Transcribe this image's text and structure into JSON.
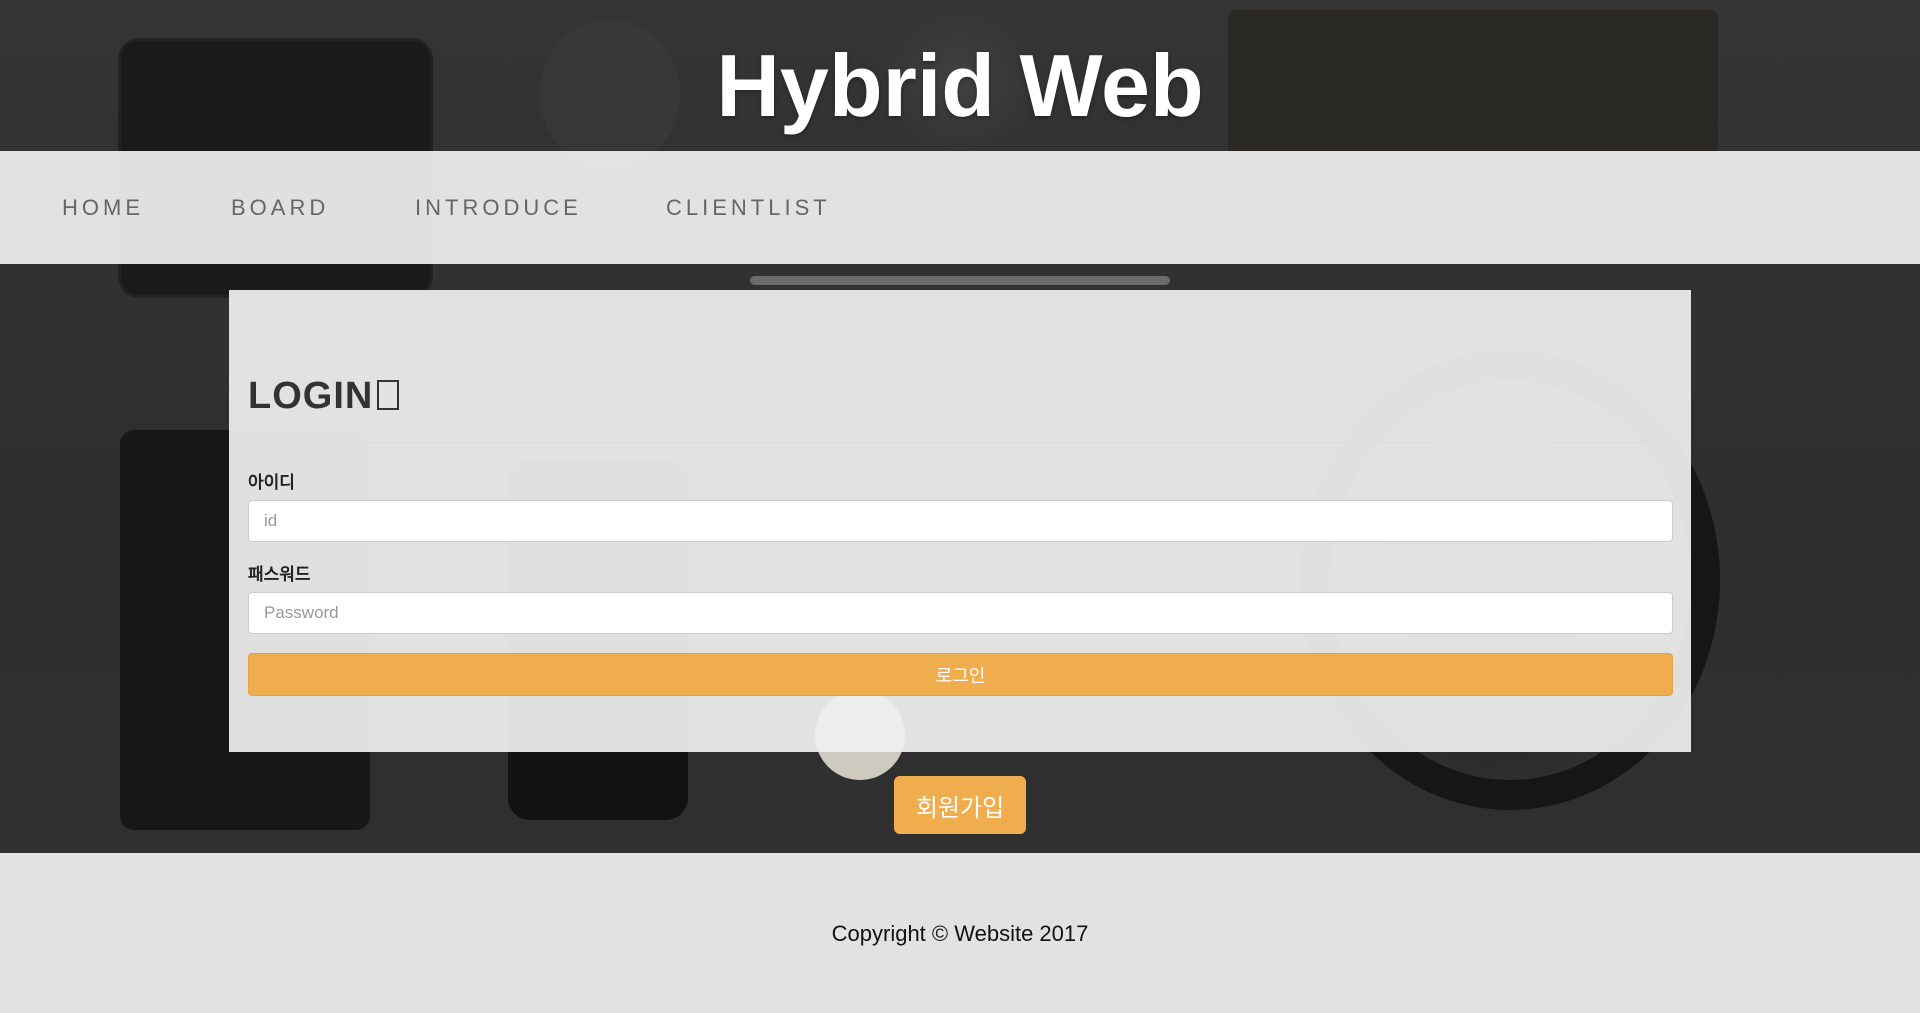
{
  "header": {
    "site_title": "Hybrid Web"
  },
  "nav": {
    "items": [
      {
        "label": "HOME"
      },
      {
        "label": "BOARD"
      },
      {
        "label": "INTRODUCE"
      },
      {
        "label": "CLIENTLIST"
      }
    ]
  },
  "login": {
    "title": "LOGIN",
    "id_label": "아이디",
    "id_placeholder": "id",
    "id_value": "",
    "password_label": "패스워드",
    "password_placeholder": "Password",
    "password_value": "",
    "submit_label": "로그인"
  },
  "signup": {
    "label": "회원가입"
  },
  "footer": {
    "copyright": "Copyright © Website 2017"
  },
  "colors": {
    "accent": "#f0ad4e",
    "panel_bg": "#f0f0f0",
    "nav_text": "#666666"
  }
}
